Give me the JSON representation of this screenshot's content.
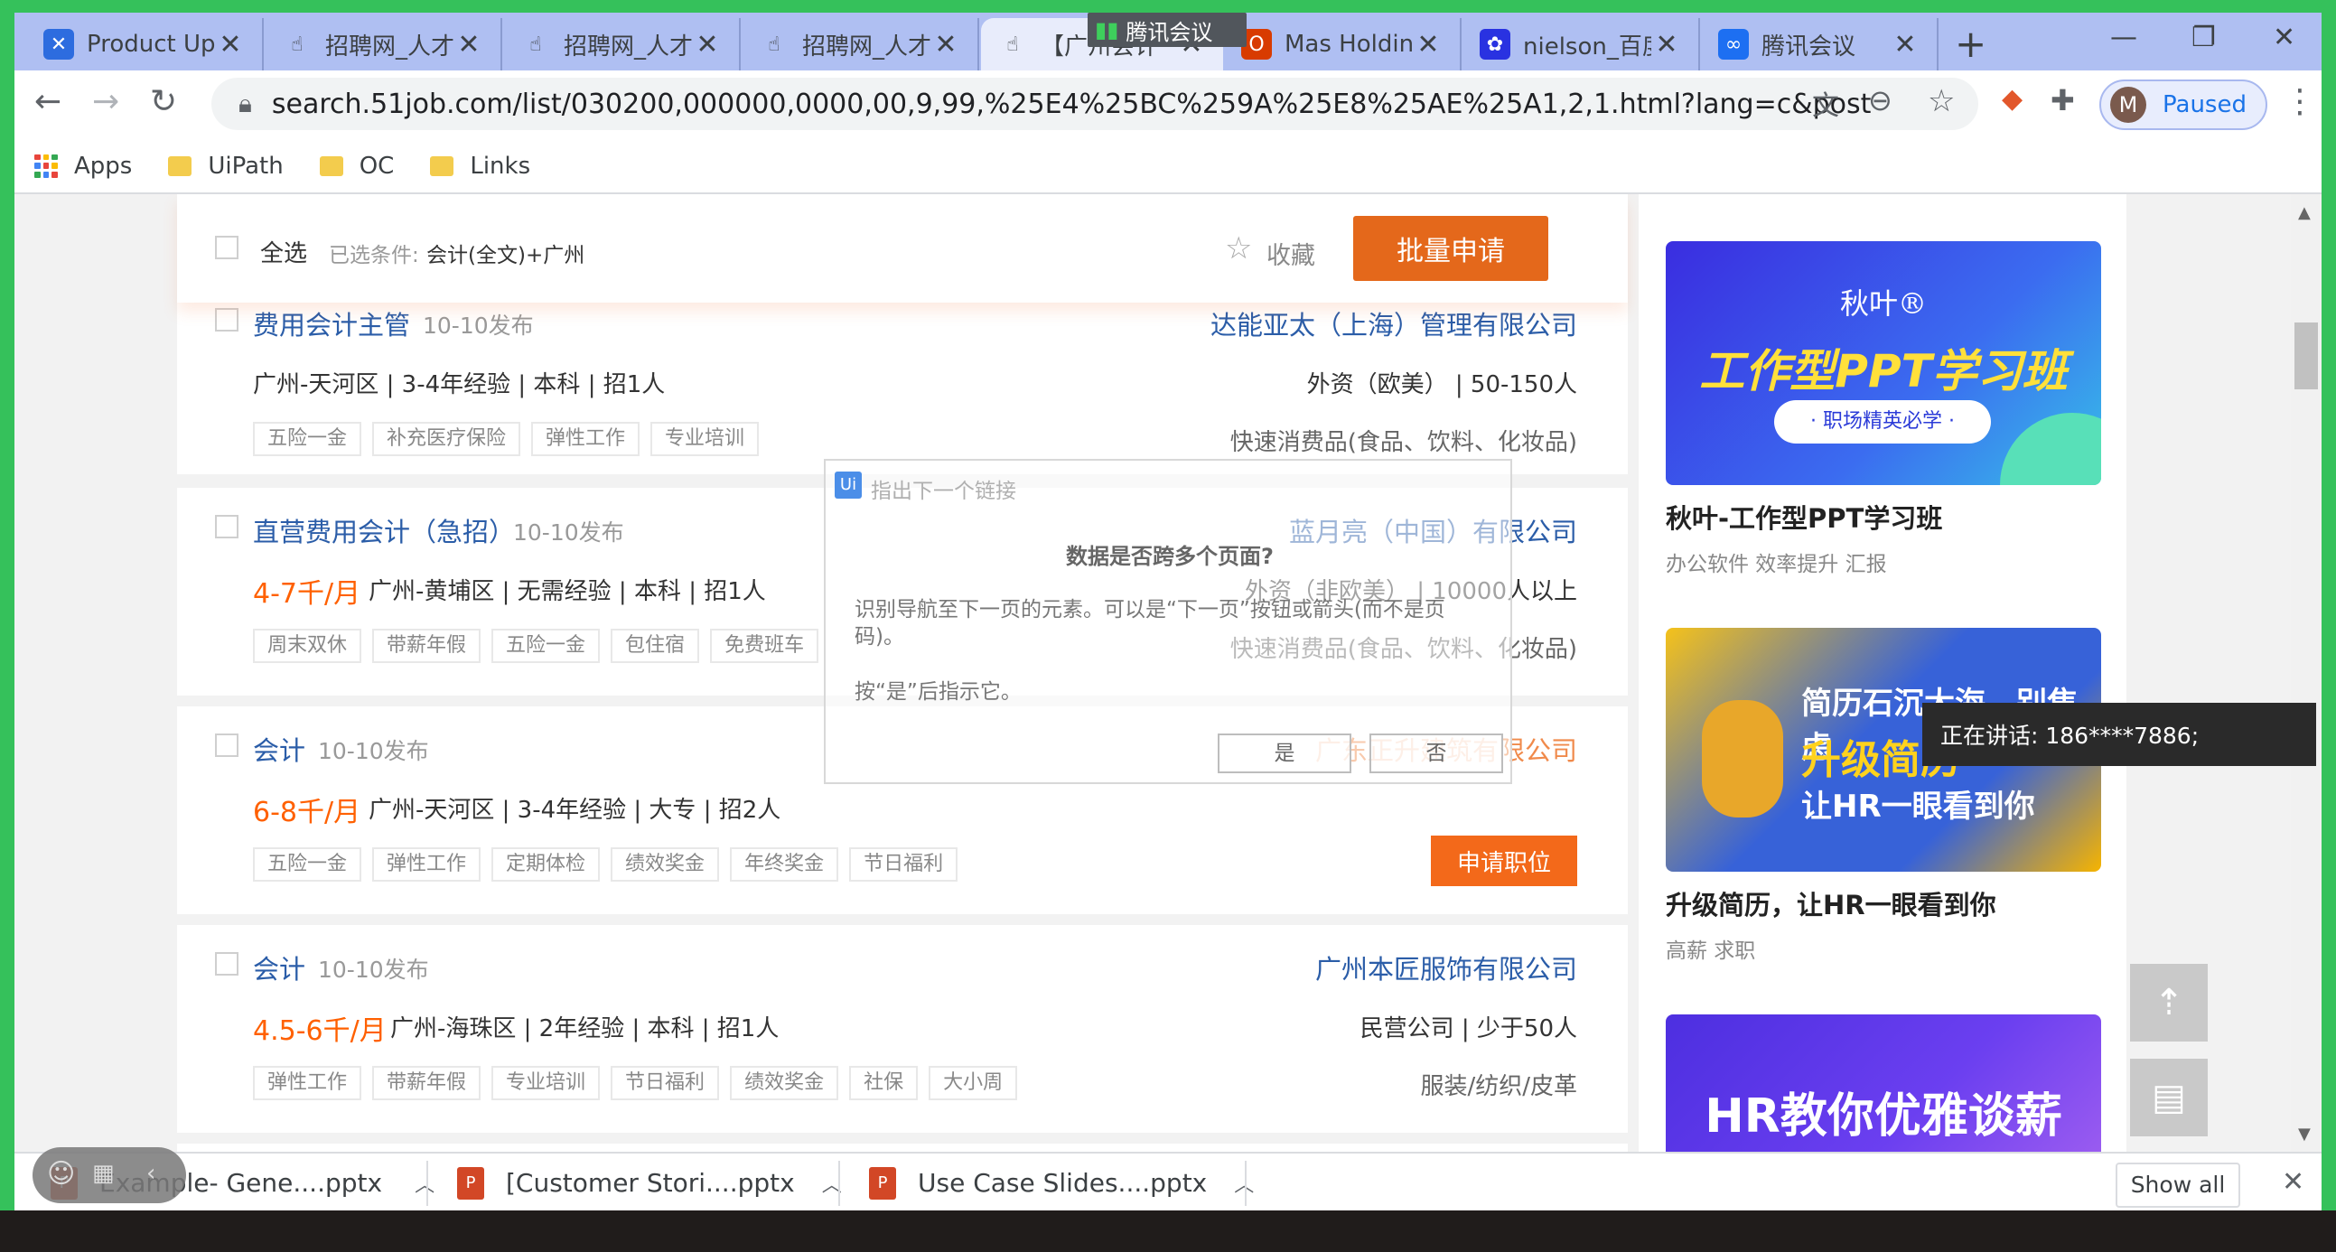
{
  "browser": {
    "tabs": [
      {
        "title": "Product Up",
        "icon": "confluence-icon"
      },
      {
        "title": "招聘网_人才",
        "icon": "hand-icon"
      },
      {
        "title": "招聘网_人才",
        "icon": "hand-icon"
      },
      {
        "title": "招聘网_人才",
        "icon": "hand-icon"
      },
      {
        "title": "【广州会计",
        "icon": "hand-icon",
        "active": true
      },
      {
        "title": "Mas Holdin",
        "icon": "office-icon"
      },
      {
        "title": "nielson_百度",
        "icon": "baidu-icon"
      },
      {
        "title": "腾讯会议",
        "icon": "tencent-meeting-icon"
      }
    ],
    "meeting_badge": "腾讯会议",
    "url": "search.51job.com/list/030200,000000,0000,00,9,99,%25E4%25BC%259A%25E8%25AE%25A1,2,1.html?lang=c&postchannel...",
    "profile_initial": "M",
    "profile_status": "Paused",
    "bookmarks": [
      "Apps",
      "UiPath",
      "OC",
      "Links"
    ]
  },
  "selection_bar": {
    "select_all": "全选",
    "conditions_label": "已选条件:",
    "conditions_value": "会计(全文)+广州",
    "favorite": "收藏",
    "batch_apply": "批量申请"
  },
  "jobs": [
    {
      "title": "费用会计主管",
      "date": "10-10发布",
      "salary": "",
      "info": "广州-天河区 | 3-4年经验 | 本科 | 招1人",
      "company": "达能亚太（上海）管理有限公司",
      "company_meta": "外资（欧美） | 50-150人",
      "industry": "快速消费品(食品、饮料、化妆品)",
      "tags": [
        "五险一金",
        "补充医疗保险",
        "弹性工作",
        "专业培训"
      ]
    },
    {
      "title": "直营费用会计（急招）",
      "date": "10-10发布",
      "salary": "4-7千/月",
      "info": "广州-黄埔区 | 无需经验 | 本科 | 招1人",
      "company": "蓝月亮（中国）有限公司",
      "company_meta": "外资（非欧美） | 10000人以上",
      "industry": "快速消费品(食品、饮料、化妆品)",
      "tags": [
        "周末双休",
        "带薪年假",
        "五险一金",
        "包住宿",
        "免费班车"
      ]
    },
    {
      "title": "会计",
      "date": "10-10发布",
      "salary": "6-8千/月",
      "info": "广州-天河区 | 3-4年经验 | 大专 | 招2人",
      "company": "广东正升建筑有限公司",
      "company_meta": "",
      "industry": "",
      "tags": [
        "五险一金",
        "弹性工作",
        "定期体检",
        "绩效奖金",
        "年终奖金",
        "节日福利"
      ],
      "apply": "申请职位"
    },
    {
      "title": "会计",
      "date": "10-10发布",
      "salary": "4.5-6千/月",
      "info": "广州-海珠区 | 2年经验 | 本科 | 招1人",
      "company": "广州本匠服饰有限公司",
      "company_meta": "民营公司 | 少于50人",
      "industry": "服装/纺织/皮革",
      "tags": [
        "弹性工作",
        "带薪年假",
        "专业培训",
        "节日福利",
        "绩效奖金",
        "社保",
        "大小周"
      ]
    }
  ],
  "dialog": {
    "header": "指出下一个链接",
    "question": "数据是否跨多个页面?",
    "body": "识别导航至下一页的元素。可以是“下一页”按钮或箭头(而不是页码)。",
    "hint": "按“是”后指示它。",
    "yes": "是",
    "no": "否"
  },
  "ads": [
    {
      "brand": "秋叶®",
      "headline": "工作型PPT学习班",
      "pill": "· 职场精英必学 ·",
      "title": "秋叶-工作型PPT学习班",
      "sub": "办公软件 效率提升 汇报"
    },
    {
      "headline1": "简历石沉大海，别焦虑",
      "headline2": "升级简历",
      "headline3": "让HR一眼看到你",
      "title": "升级简历，让HR一眼看到你",
      "sub": "高薪 求职"
    },
    {
      "headline": "HR教你优雅谈薪"
    }
  ],
  "speaking": "正在讲话: 186****7886;",
  "downloads": {
    "items": [
      "Example- Gene....pptx",
      "[Customer Stori....pptx",
      "Use Case Slides....pptx"
    ],
    "show_all": "Show all"
  }
}
